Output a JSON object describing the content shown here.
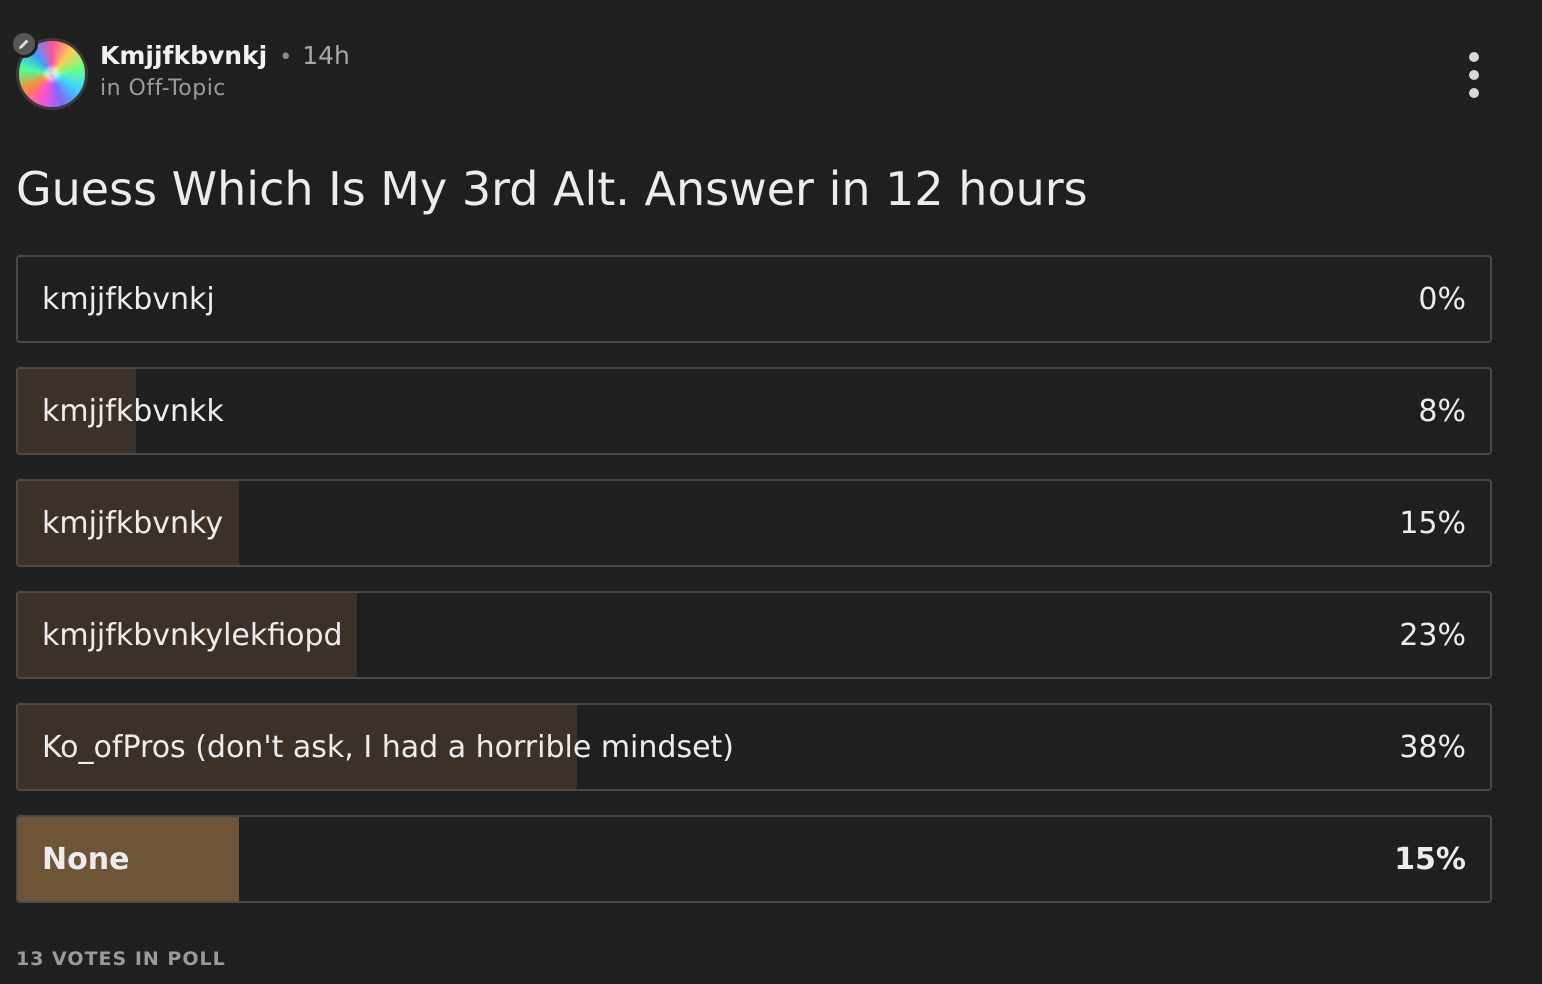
{
  "post": {
    "author": "Kmjjfkbvnkj",
    "separator": "•",
    "time_ago": "14h",
    "community": "in Off-Topic",
    "title": "Guess Which Is My 3rd Alt. Answer in 12 hours"
  },
  "poll": {
    "options": [
      {
        "label": "kmjjfkbvnkj",
        "percent_text": "0%",
        "percent": 0,
        "selected": false
      },
      {
        "label": "kmjjfkbvnkk",
        "percent_text": "8%",
        "percent": 8,
        "selected": false
      },
      {
        "label": "kmjjfkbvnky",
        "percent_text": "15%",
        "percent": 15,
        "selected": false
      },
      {
        "label": "kmjjfkbvnkylekfiopd",
        "percent_text": "23%",
        "percent": 23,
        "selected": false
      },
      {
        "label": "Ko_ofPros (don't ask, I had a horrible mindset)",
        "percent_text": "38%",
        "percent": 38,
        "selected": false
      },
      {
        "label": "None",
        "percent_text": "15%",
        "percent": 15,
        "selected": true
      }
    ],
    "votes_text": "13 VOTES IN POLL"
  },
  "icons": {
    "avatar": "avatar-image",
    "edit": "pencil-icon",
    "menu": "more-vertical-icon"
  },
  "colors": {
    "background": "#1f1f1f",
    "result_fill": "#3b3128",
    "selected_fill": "#6e5538",
    "border": "#4a4a4a"
  }
}
